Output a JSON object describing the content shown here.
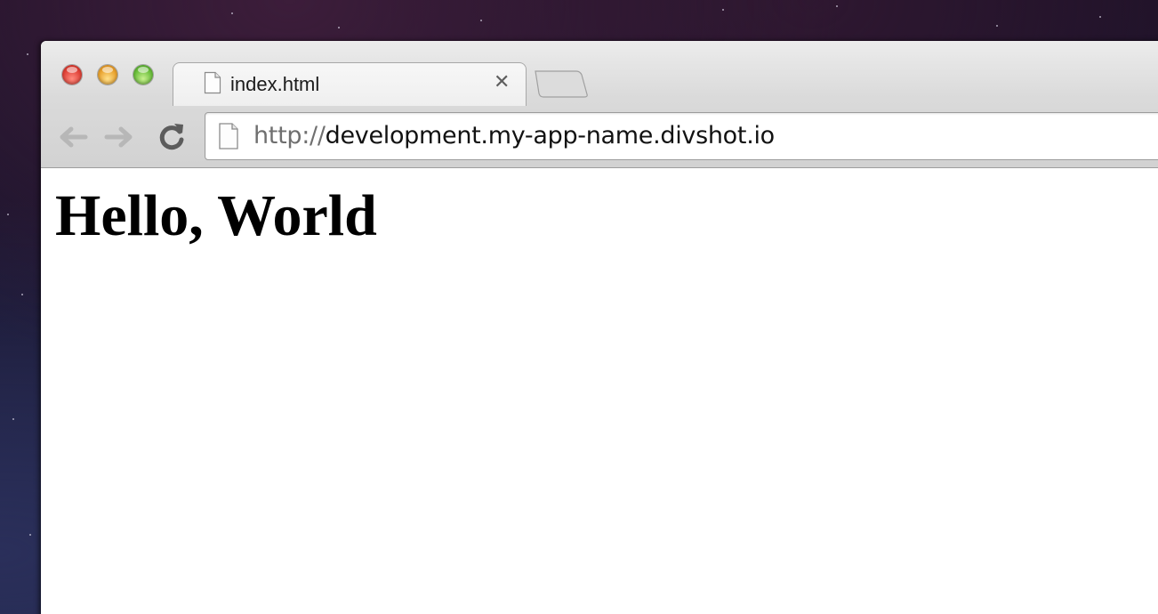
{
  "window": {
    "controls": {
      "close_color": "#e0443a",
      "minimize_color": "#eaa431",
      "maximize_color": "#6cbf3d"
    }
  },
  "tabs": [
    {
      "title": "index.html",
      "icon": "document-icon",
      "close_glyph": "✕",
      "active": true
    }
  ],
  "toolbar": {
    "back_icon": "arrow-left-icon",
    "forward_icon": "arrow-right-icon",
    "reload_icon": "reload-icon"
  },
  "address_bar": {
    "icon": "document-icon",
    "scheme": "http://",
    "host": "development.my-app-name.divshot.io"
  },
  "page": {
    "heading": "Hello, World"
  }
}
